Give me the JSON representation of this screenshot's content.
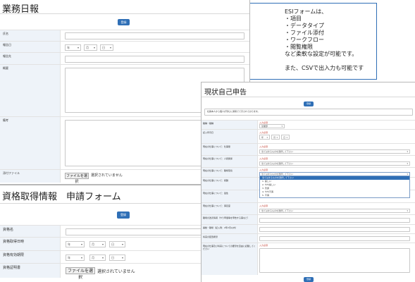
{
  "note": {
    "lines": [
      "ESIフォームは、",
      "・項目",
      "・データタイプ",
      "・ファイル添付",
      "・ワークフロー",
      "・閲覧権限",
      "など柔軟な設定が可能です。",
      "",
      "また、CSVで出入力も可能です"
    ]
  },
  "daily": {
    "title": "業務日報",
    "submit": "登録",
    "labels": [
      "氏名",
      "報告日",
      "報告先",
      "概要",
      "備考",
      "添付ファイル"
    ],
    "date_selects": [
      "年",
      "月",
      "日"
    ],
    "file_button": "ファイルを選択",
    "file_status": "選択されていません"
  },
  "qual": {
    "title": "資格取得情報　申請フォーム",
    "submit": "登録",
    "labels": [
      "資格名",
      "資格取得日時",
      "資格有効期限",
      "資格証明書"
    ],
    "date_selects": [
      "年",
      "月",
      "日"
    ],
    "file_button": "ファイルを選択",
    "file_status": "選択されていません"
  },
  "self": {
    "title": "現状自己申告",
    "submit": "登録",
    "description": "社員本人から個人が望むに通用でて示されております。",
    "required": "入力必須",
    "labels": [
      "職種・職種",
      "記入年月日",
      "現在の仕事について：仕事量",
      "現在の仕事について：人間関係",
      "現在の仕事について：職場環境",
      "現在の仕事について：報酬",
      "現在の仕事について：適性",
      "現在の仕事について：満足度",
      "職場の改善情報（やり甲斐等を申告する事など）",
      "異動・職場（記入例：2年2月以内）",
      "将来の配置希望",
      "現在の仕事及び将来についての要望を自由に記載してください"
    ],
    "select_placeholder": "当てはまるものを選択して下さい",
    "dept_value": "営業部",
    "date_selects": [
      "年",
      "月",
      "日"
    ],
    "dropdown_options": [
      "当てはまるものを選択して下さい",
      "1. 楽しい",
      "2. やや楽しい",
      "3. 普通",
      "4. やや不満",
      "5. 不満"
    ],
    "bottom_button": "登録"
  }
}
